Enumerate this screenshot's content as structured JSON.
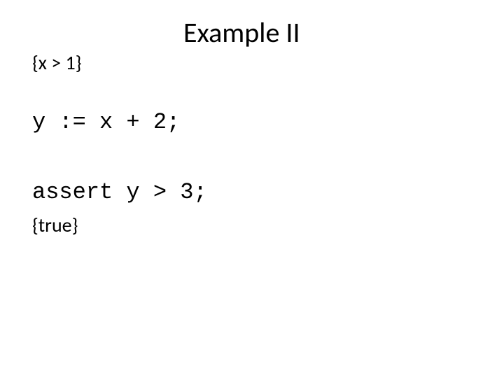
{
  "slide": {
    "title": "Example II",
    "precondition": "{x > 1}",
    "code_line_1": "y := x + 2;",
    "code_line_2": "assert y > 3;",
    "postcondition": "{true}"
  }
}
